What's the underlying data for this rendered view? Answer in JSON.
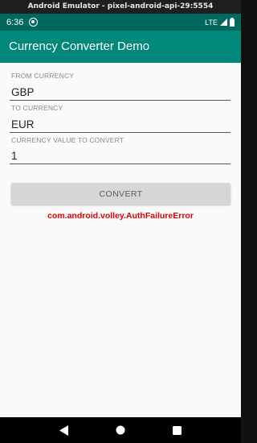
{
  "emulator": {
    "title": "Android Emulator - pixel-android-api-29:5554"
  },
  "status_bar": {
    "time": "6:36",
    "network": "LTE"
  },
  "app_bar": {
    "title": "Currency Converter Demo"
  },
  "form": {
    "from_label": "FROM CURRENCY",
    "from_value": "GBP",
    "to_label": "TO CURRENCY",
    "to_value": "EUR",
    "amount_label": "CURRENCY VALUE TO CONVERT",
    "amount_value": "1",
    "convert_label": "CONVERT"
  },
  "result": {
    "error_text": "com.android.volley.AuthFailureError"
  },
  "colors": {
    "status_bar": "#00695f",
    "app_bar": "#00897b",
    "error": "#e00000",
    "button": "#d6d6d6"
  },
  "nav_bar": {
    "icons": [
      "back-icon",
      "home-icon",
      "recents-icon"
    ]
  }
}
